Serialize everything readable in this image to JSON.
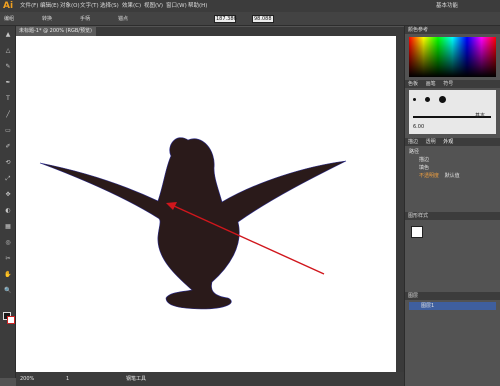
{
  "app": {
    "logo": "Ai"
  },
  "menu": [
    "文件(F)",
    "编辑(E)",
    "对象(O)",
    "文字(T)",
    "选择(S)",
    "效果(C)",
    "视图(V)",
    "窗口(W)",
    "帮助(H)"
  ],
  "workspace_label": "基本功能",
  "control_bar": {
    "group_label": "编组",
    "mode_label": "转换",
    "anchor_label": "锚点",
    "handle_label": "手柄",
    "x_value": "187.386",
    "y_value": "98.088",
    "w_label": "宽",
    "h_label": "高"
  },
  "document_tab": "未标题-1* @ 200% (RGB/预览)",
  "status": {
    "zoom": "200%",
    "page": "1",
    "tool_name": "钢笔工具"
  },
  "panels": {
    "color": {
      "title": "颜色参考",
      "tabs": [
        "色板",
        "画笔",
        "符号"
      ]
    },
    "brushes": {
      "title": "画笔",
      "size_label": "6.00",
      "basic": "基本"
    },
    "appearance": {
      "tab_title": "外观",
      "other_tabs": [
        "描边",
        "透明"
      ],
      "path": "路径",
      "stroke": "描边",
      "fill": "填色",
      "opacity": "不透明度",
      "opacity_value": "默认值"
    },
    "graphic_styles": {
      "title": "图形样式"
    },
    "layers": {
      "title": "图层",
      "layer_name": "图层1"
    }
  },
  "colors": {
    "silhouette": "#2a1a1a",
    "arrow": "#d0161c",
    "path_outline": "#2a2a8a"
  }
}
